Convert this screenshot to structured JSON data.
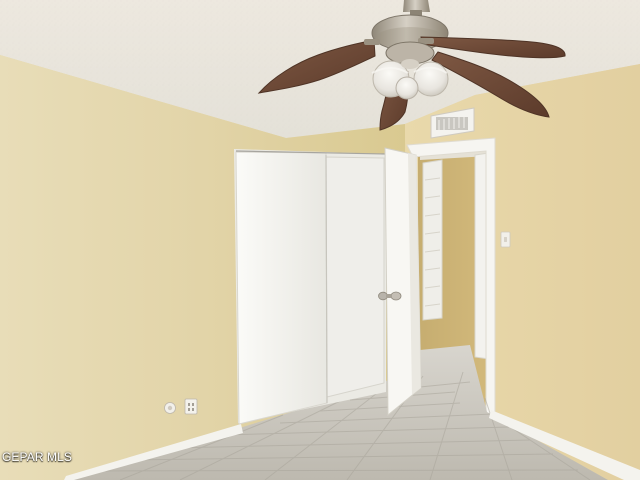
{
  "watermark": {
    "text": "GEPAR MLS"
  },
  "colors": {
    "wall": "#e4d6aa",
    "ceiling": "#ebe8e2",
    "door": "#f6f5f1",
    "floor": "#c7c4bc",
    "baseboard": "#f3f2ec",
    "fan_blade": "#6f4a36",
    "fan_metal": "#b6ad9d"
  },
  "icons": {
    "ceiling_fan": "ceiling-fan-icon",
    "air_vent": "air-vent-icon",
    "light_switch": "light-switch-icon",
    "electrical_outlet": "outlet-icon",
    "door_knob": "door-knob-icon"
  }
}
